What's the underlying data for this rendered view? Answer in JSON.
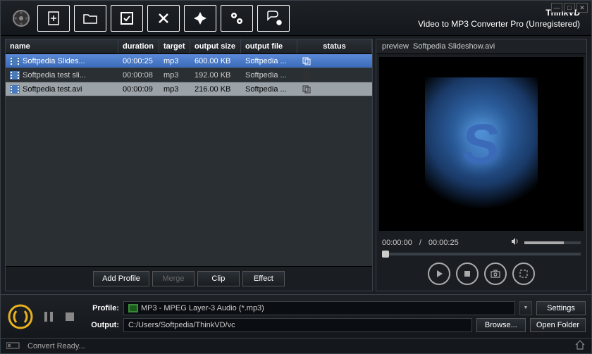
{
  "title": {
    "brand": "ThinkVD",
    "product": "Video to MP3 Converter Pro (Unregistered)"
  },
  "toolbar_icons": [
    "add-file-icon",
    "open-folder-icon",
    "check-icon",
    "remove-icon",
    "effects-icon",
    "settings-icon",
    "help-icon"
  ],
  "columns": {
    "name": "name",
    "duration": "duration",
    "target": "target",
    "size": "output size",
    "file": "output file",
    "status": "status"
  },
  "rows": [
    {
      "name": "Softpedia Slides...",
      "duration": "00:00:25",
      "target": "mp3",
      "size": "600.00 KB",
      "file": "Softpedia ...",
      "selected": true
    },
    {
      "name": "Softpedia test sli...",
      "duration": "00:00:08",
      "target": "mp3",
      "size": "192.00 KB",
      "file": "Softpedia ...",
      "selected": false
    },
    {
      "name": "Softpedia test.avi",
      "duration": "00:00:09",
      "target": "mp3",
      "size": "216.00 KB",
      "file": "Softpedia ...",
      "selected": false
    }
  ],
  "left_buttons": {
    "add_profile": "Add Profile",
    "merge": "Merge",
    "clip": "Clip",
    "effect": "Effect"
  },
  "preview": {
    "label": "preview",
    "filename": "Softpedia Slideshow.avi",
    "current": "00:00:00",
    "total": "00:00:25"
  },
  "profile": {
    "label": "Profile:",
    "value": "MP3 - MPEG Layer-3 Audio (*.mp3)"
  },
  "output": {
    "label": "Output:",
    "value": "C:/Users/Softpedia/ThinkVD/vc"
  },
  "buttons": {
    "settings": "Settings",
    "browse": "Browse...",
    "open_folder": "Open Folder"
  },
  "status": "Convert Ready..."
}
